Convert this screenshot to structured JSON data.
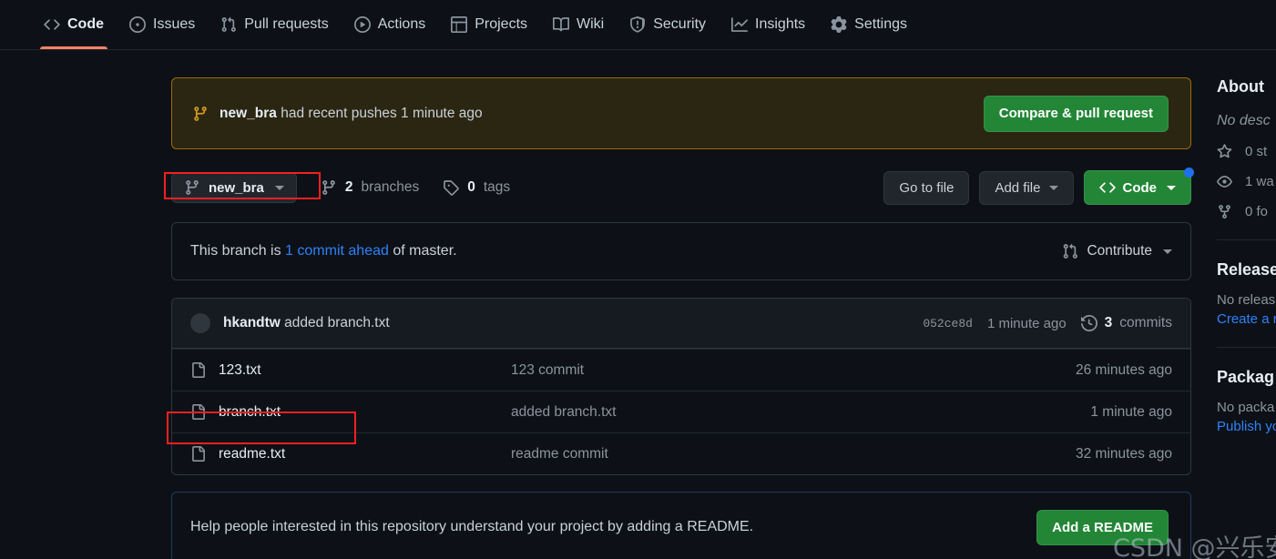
{
  "nav": {
    "items": [
      {
        "label": "Code",
        "icon": "code-icon",
        "active": true
      },
      {
        "label": "Issues",
        "icon": "issue-opened-icon",
        "active": false
      },
      {
        "label": "Pull requests",
        "icon": "git-pull-request-icon",
        "active": false
      },
      {
        "label": "Actions",
        "icon": "play-icon",
        "active": false
      },
      {
        "label": "Projects",
        "icon": "table-icon",
        "active": false
      },
      {
        "label": "Wiki",
        "icon": "book-icon",
        "active": false
      },
      {
        "label": "Security",
        "icon": "shield-icon",
        "active": false
      },
      {
        "label": "Insights",
        "icon": "graph-icon",
        "active": false
      },
      {
        "label": "Settings",
        "icon": "gear-icon",
        "active": false
      }
    ]
  },
  "push_banner": {
    "icon": "git-branch-icon",
    "branch": "new_bra",
    "message": " had recent pushes 1 minute ago",
    "button_label": "Compare & pull request"
  },
  "branch_bar": {
    "selected_branch": "new_bra",
    "branch_icon": "git-branch-icon",
    "branches_count": "2",
    "branches_label": "branches",
    "branches_icon": "git-branch-icon",
    "tags_count": "0",
    "tags_label": "tags",
    "tags_icon": "tag-icon",
    "go_to_file": "Go to file",
    "add_file": "Add file",
    "code_label": "Code",
    "code_icon": "code-icon"
  },
  "branch_status": {
    "prefix": "This branch is ",
    "link": "1 commit ahead",
    "suffix": " of master.",
    "contribute_label": "Contribute",
    "contribute_icon": "git-pull-request-icon"
  },
  "commit_header": {
    "author": "hkandtw",
    "message": " added branch.txt",
    "sha": "052ce8d",
    "time": "1 minute ago",
    "commits_count": "3",
    "commits_label": "commits",
    "history_icon": "history-icon"
  },
  "files": [
    {
      "name": "123.txt",
      "icon": "file-icon",
      "commit": "123 commit",
      "time": "26 minutes ago"
    },
    {
      "name": "branch.txt",
      "icon": "file-icon",
      "commit": "added branch.txt",
      "time": "1 minute ago"
    },
    {
      "name": "readme.txt",
      "icon": "file-icon",
      "commit": "readme commit",
      "time": "32 minutes ago"
    }
  ],
  "readme_callout": {
    "text": "Help people interested in this repository understand your project by adding a README.",
    "button_label": "Add a README"
  },
  "sidebar": {
    "about_title": "About",
    "description": "No desc",
    "stats": [
      {
        "icon": "star-icon",
        "text": "0 st"
      },
      {
        "icon": "eye-icon",
        "text": "1 wa"
      },
      {
        "icon": "git-branch-icon",
        "text": "0 fo"
      }
    ],
    "releases_title": "Release",
    "releases_empty": "No releas",
    "releases_link": "Create a r",
    "packages_title": "Packag",
    "packages_empty": "No packa",
    "packages_link": "Publish yo"
  },
  "watermark": {
    "text": "CSDN @兴乐安宁"
  },
  "colors": {
    "background": "#0d1117",
    "accent_green": "#238636",
    "accent_blue": "#2f81f7",
    "accent_orange": "#f78166",
    "banner_amber": "#d29922",
    "annotation_red": "#f42020"
  }
}
